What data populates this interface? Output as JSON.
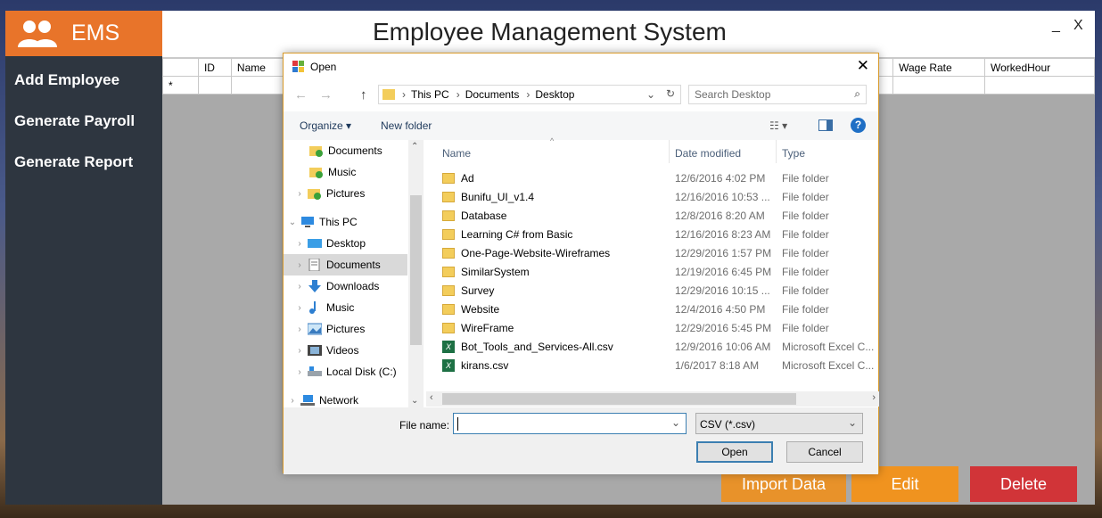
{
  "app": {
    "brand": "EMS",
    "title": "Employee Management System",
    "nav": [
      "Add Employee",
      "Generate Payroll",
      "Generate Report"
    ],
    "window_minimize": "_",
    "window_close": "X",
    "grid_columns": [
      "ID",
      "Name",
      "Wage Rate",
      "WorkedHour"
    ],
    "new_row_marker": "*",
    "buttons": {
      "import": "Import Data",
      "edit": "Edit",
      "delete": "Delete"
    },
    "colors": {
      "brand": "#e8742a",
      "sidebar": "#2e3640",
      "import": "#e8922a",
      "edit": "#f0931f",
      "delete": "#d13438"
    }
  },
  "dialog": {
    "title": "Open",
    "close": "✕",
    "path": [
      "This PC",
      "Documents",
      "Desktop"
    ],
    "search_placeholder": "Search Desktop",
    "toolbar": {
      "organize": "Organize ▾",
      "new_folder": "New folder",
      "help": "?"
    },
    "tree": [
      {
        "label": "Documents",
        "icon": "folder-check-icon"
      },
      {
        "label": "Music",
        "icon": "folder-check-icon"
      },
      {
        "label": "Pictures",
        "icon": "folder-check-icon"
      },
      {
        "label": "This PC",
        "icon": "computer-icon"
      },
      {
        "label": "Desktop",
        "icon": "desktop-icon"
      },
      {
        "label": "Documents",
        "icon": "documents-icon"
      },
      {
        "label": "Downloads",
        "icon": "download-icon"
      },
      {
        "label": "Music",
        "icon": "music-icon"
      },
      {
        "label": "Pictures",
        "icon": "pictures-icon"
      },
      {
        "label": "Videos",
        "icon": "videos-icon"
      },
      {
        "label": "Local Disk (C:)",
        "icon": "disk-icon"
      },
      {
        "label": "Network",
        "icon": "network-icon"
      }
    ],
    "columns": {
      "name": "Name",
      "date": "Date modified",
      "type": "Type"
    },
    "files": [
      {
        "name": "Ad",
        "date": "12/6/2016 4:02 PM",
        "type": "File folder",
        "kind": "folder"
      },
      {
        "name": "Bunifu_UI_v1.4",
        "date": "12/16/2016 10:53 ...",
        "type": "File folder",
        "kind": "folder"
      },
      {
        "name": "Database",
        "date": "12/8/2016 8:20 AM",
        "type": "File folder",
        "kind": "folder"
      },
      {
        "name": "Learning C# from Basic",
        "date": "12/16/2016 8:23 AM",
        "type": "File folder",
        "kind": "folder"
      },
      {
        "name": "One-Page-Website-Wireframes",
        "date": "12/29/2016 1:57 PM",
        "type": "File folder",
        "kind": "folder"
      },
      {
        "name": "SimilarSystem",
        "date": "12/19/2016 6:45 PM",
        "type": "File folder",
        "kind": "folder"
      },
      {
        "name": "Survey",
        "date": "12/29/2016 10:15 ...",
        "type": "File folder",
        "kind": "folder"
      },
      {
        "name": "Website",
        "date": "12/4/2016 4:50 PM",
        "type": "File folder",
        "kind": "folder"
      },
      {
        "name": "WireFrame",
        "date": "12/29/2016 5:45 PM",
        "type": "File folder",
        "kind": "folder"
      },
      {
        "name": "Bot_Tools_and_Services-All.csv",
        "date": "12/9/2016 10:06 AM",
        "type": "Microsoft Excel C...",
        "kind": "csv"
      },
      {
        "name": "kirans.csv",
        "date": "1/6/2017 8:18 AM",
        "type": "Microsoft Excel C...",
        "kind": "csv"
      }
    ],
    "file_name_label": "File name:",
    "file_name_value": "",
    "file_type": "CSV (*.csv)",
    "open_button": "Open",
    "cancel_button": "Cancel"
  }
}
